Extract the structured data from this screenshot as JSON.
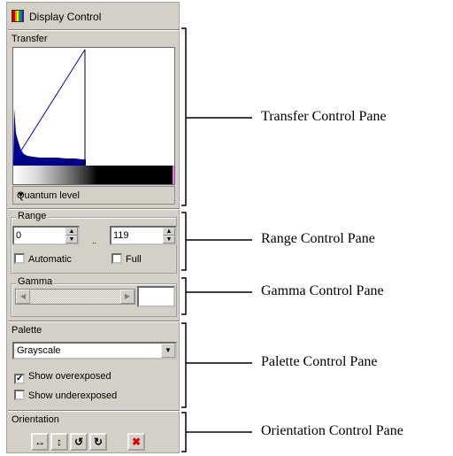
{
  "window": {
    "title": "Display Control",
    "app_icon": "palette-icon"
  },
  "transfer": {
    "label": "Transfer",
    "mode_dropdown": "Quantum level"
  },
  "range": {
    "label": "Range",
    "min_value": "0",
    "separator": "..",
    "max_value": "119",
    "automatic_label": "Automatic",
    "automatic_checked": false,
    "full_label": "Full",
    "full_checked": false
  },
  "gamma": {
    "label": "Gamma",
    "value": ""
  },
  "palette": {
    "label": "Palette",
    "selected": "Grayscale",
    "show_overexposed_label": "Show overexposed",
    "show_overexposed_checked": true,
    "show_underexposed_label": "Show underexposed",
    "show_underexposed_checked": false
  },
  "orientation": {
    "label": "Orientation",
    "buttons": [
      "flip-horizontal-icon",
      "flip-vertical-icon",
      "rotate-ccw-icon",
      "rotate-cw-icon",
      "reset-orientation-icon"
    ]
  },
  "annotations": {
    "transfer": "Transfer Control Pane",
    "range": "Range Control Pane",
    "gamma": "Gamma Control Pane",
    "palette": "Palette Control Pane",
    "orientation": "Orientation Control Pane"
  },
  "colors": {
    "histogram": "#00008b",
    "curve": "#0000cc",
    "overexposed": "#ff66ff",
    "panel": "#d4d0c8"
  }
}
